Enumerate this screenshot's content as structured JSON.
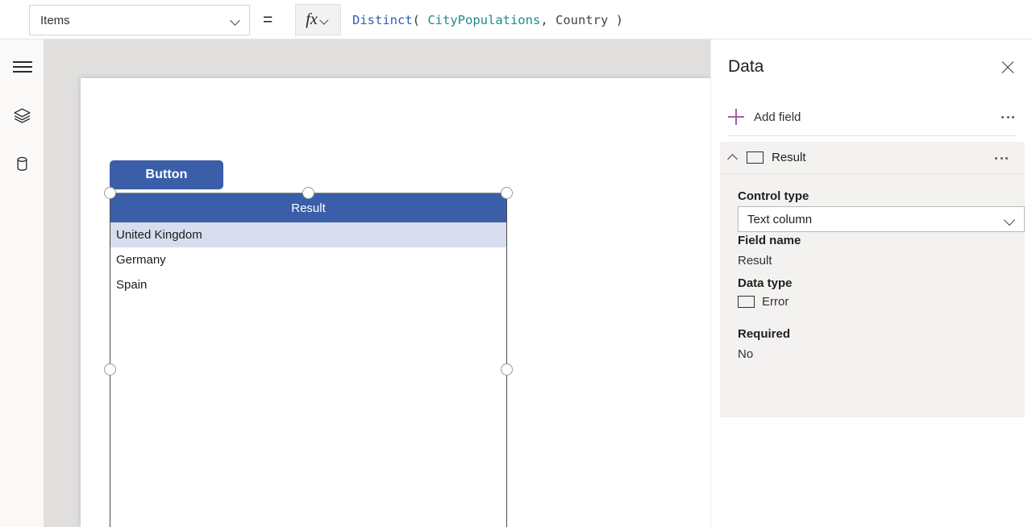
{
  "formula_bar": {
    "property_dropdown": "Items",
    "equals": "=",
    "fx_label": "fx",
    "formula_tokens": {
      "fn": "Distinct",
      "open_paren": "( ",
      "table": "CityPopulations",
      "comma": ", ",
      "column": "Country",
      "close_paren": " )"
    },
    "formula_full": "Distinct( CityPopulations, Country )"
  },
  "left_rail": {
    "items": [
      {
        "name": "menu",
        "icon": "hamburger-icon"
      },
      {
        "name": "tree-view",
        "icon": "layers-icon"
      },
      {
        "name": "data-sources",
        "icon": "database-icon"
      }
    ]
  },
  "canvas": {
    "button": {
      "label": "Button"
    },
    "gallery": {
      "header": "Result",
      "rows": [
        {
          "value": "United Kingdom",
          "selected": true
        },
        {
          "value": "Germany",
          "selected": false
        },
        {
          "value": "Spain",
          "selected": false
        }
      ]
    }
  },
  "data_panel": {
    "title": "Data",
    "close_label": "Close",
    "add_field": "Add field",
    "more_label": "More options",
    "field": {
      "name": "Result",
      "control_type_label": "Control type",
      "control_type_value": "Text column",
      "field_name_label": "Field name",
      "field_name_value": "Result",
      "data_type_label": "Data type",
      "data_type_value": "Error",
      "required_label": "Required",
      "required_value": "No"
    }
  },
  "colors": {
    "accent_blue": "#3b5ea8",
    "selected_row": "#d7ddee",
    "add_field_purple": "#a4619f",
    "canvas_bg": "#e0dfde",
    "card_bg": "#f3f2f1"
  }
}
